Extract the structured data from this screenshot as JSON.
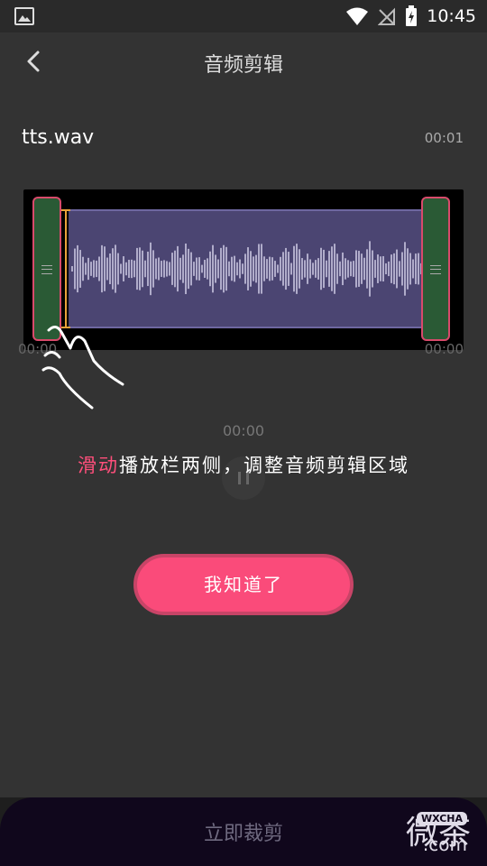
{
  "status_bar": {
    "time": "10:45"
  },
  "header": {
    "title": "音频剪辑"
  },
  "file": {
    "name": "tts.wav",
    "duration": "00:01"
  },
  "timeline": {
    "start_tick": "00:00",
    "end_tick": "00:00",
    "current_time": "00:00"
  },
  "guide": {
    "highlight": "滑动",
    "text": "播放栏两侧，调整音频剪辑区域"
  },
  "confirm_button": {
    "label": "我知道了"
  },
  "bottom": {
    "cut_label": "立即裁剪"
  },
  "watermark": {
    "text": "微茶",
    "badge": "WXCHA",
    "domain": ".com"
  },
  "colors": {
    "accent": "#fa4b7a",
    "wave": "#4b4572",
    "handle": "#2a5a35"
  }
}
